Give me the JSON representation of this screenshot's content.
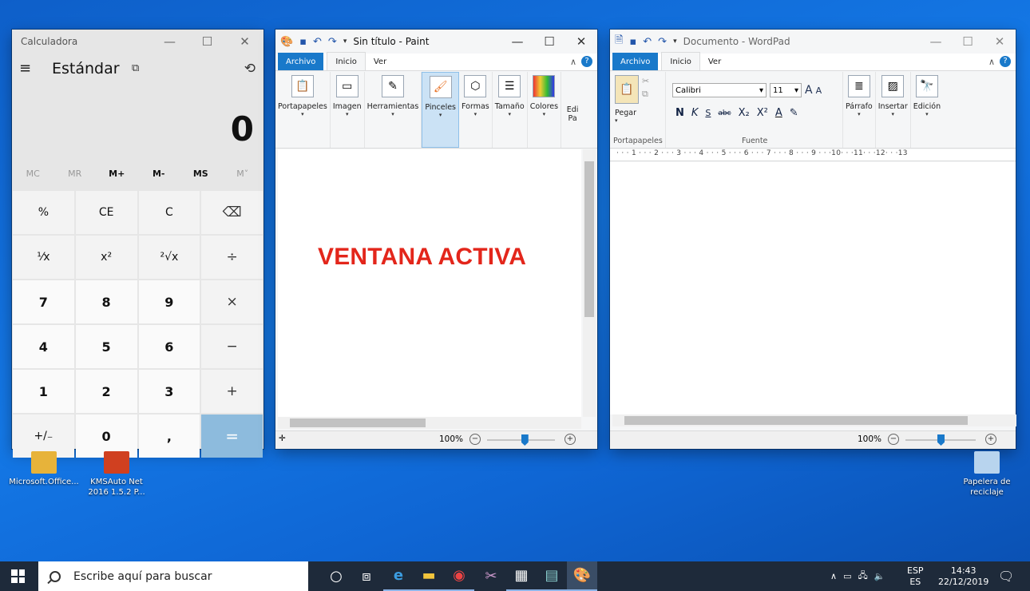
{
  "calculator": {
    "title": "Calculadora",
    "mode": "Estándar",
    "display": "0",
    "memory": [
      "MC",
      "MR",
      "M+",
      "M-",
      "MS",
      "M˅"
    ],
    "keys": [
      "%",
      "CE",
      "C",
      "⌫",
      "⅟x",
      "x²",
      "²√x",
      "÷",
      "7",
      "8",
      "9",
      "×",
      "4",
      "5",
      "6",
      "−",
      "1",
      "2",
      "3",
      "+",
      "+/₋",
      "0",
      ",",
      "="
    ]
  },
  "paint": {
    "title": "Sin título - Paint",
    "tabs": [
      "Archivo",
      "Inicio",
      "Ver"
    ],
    "groups": [
      "Portapapeles",
      "Imagen",
      "Herramientas",
      "Pinceles",
      "Formas",
      "Tamaño",
      "Colores",
      "Edi Pa"
    ],
    "canvas_text": "VENTANA ACTIVA",
    "zoom": "100%",
    "zoom_level": 0.55
  },
  "wordpad": {
    "title": "Documento - WordPad",
    "tabs": [
      "Archivo",
      "Inicio",
      "Ver"
    ],
    "paste": "Pegar",
    "font": "Calibri",
    "size": "11",
    "format": [
      "N",
      "K",
      "S",
      "abc",
      "X₂",
      "X²",
      "A"
    ],
    "right_groups": [
      "Párrafo",
      "Insertar",
      "Edición"
    ],
    "group_labels": [
      "Portapapeles",
      "Fuente"
    ],
    "ruler": "· · · 1 · · · 2 · · · 3 · · · 4 · · · 5 · · · 6 · · · 7 · · · 8 · · · 9 · · ·10· · ·11· · ·12· · ·13",
    "zoom": "100%",
    "zoom_level": 0.5
  },
  "desktop": {
    "icons": [
      {
        "label": "Microsoft.Office...",
        "color": "#e7b33a"
      },
      {
        "label": "KMSAuto Net 2016 1.5.2 P...",
        "color": "#d04020"
      },
      {
        "label": "Papelera de reciclaje",
        "color": "#b8d4ee"
      }
    ]
  },
  "taskbar": {
    "search_placeholder": "Escribe aquí para buscar",
    "apps": [
      "cortana-icon",
      "task-view-icon",
      "edge-icon",
      "file-explorer-icon",
      "chrome-icon",
      "snipping-tool-icon",
      "calculator-icon",
      "wordpad-icon",
      "paint-icon"
    ],
    "lang_top": "ESP",
    "lang_bottom": "ES",
    "time": "14:43",
    "date": "22/12/2019"
  },
  "colors": {
    "accent": "#1979ca",
    "taskbar": "#1e2a3a",
    "highlight": "#e3261b",
    "equals": "#8dbbdd"
  }
}
